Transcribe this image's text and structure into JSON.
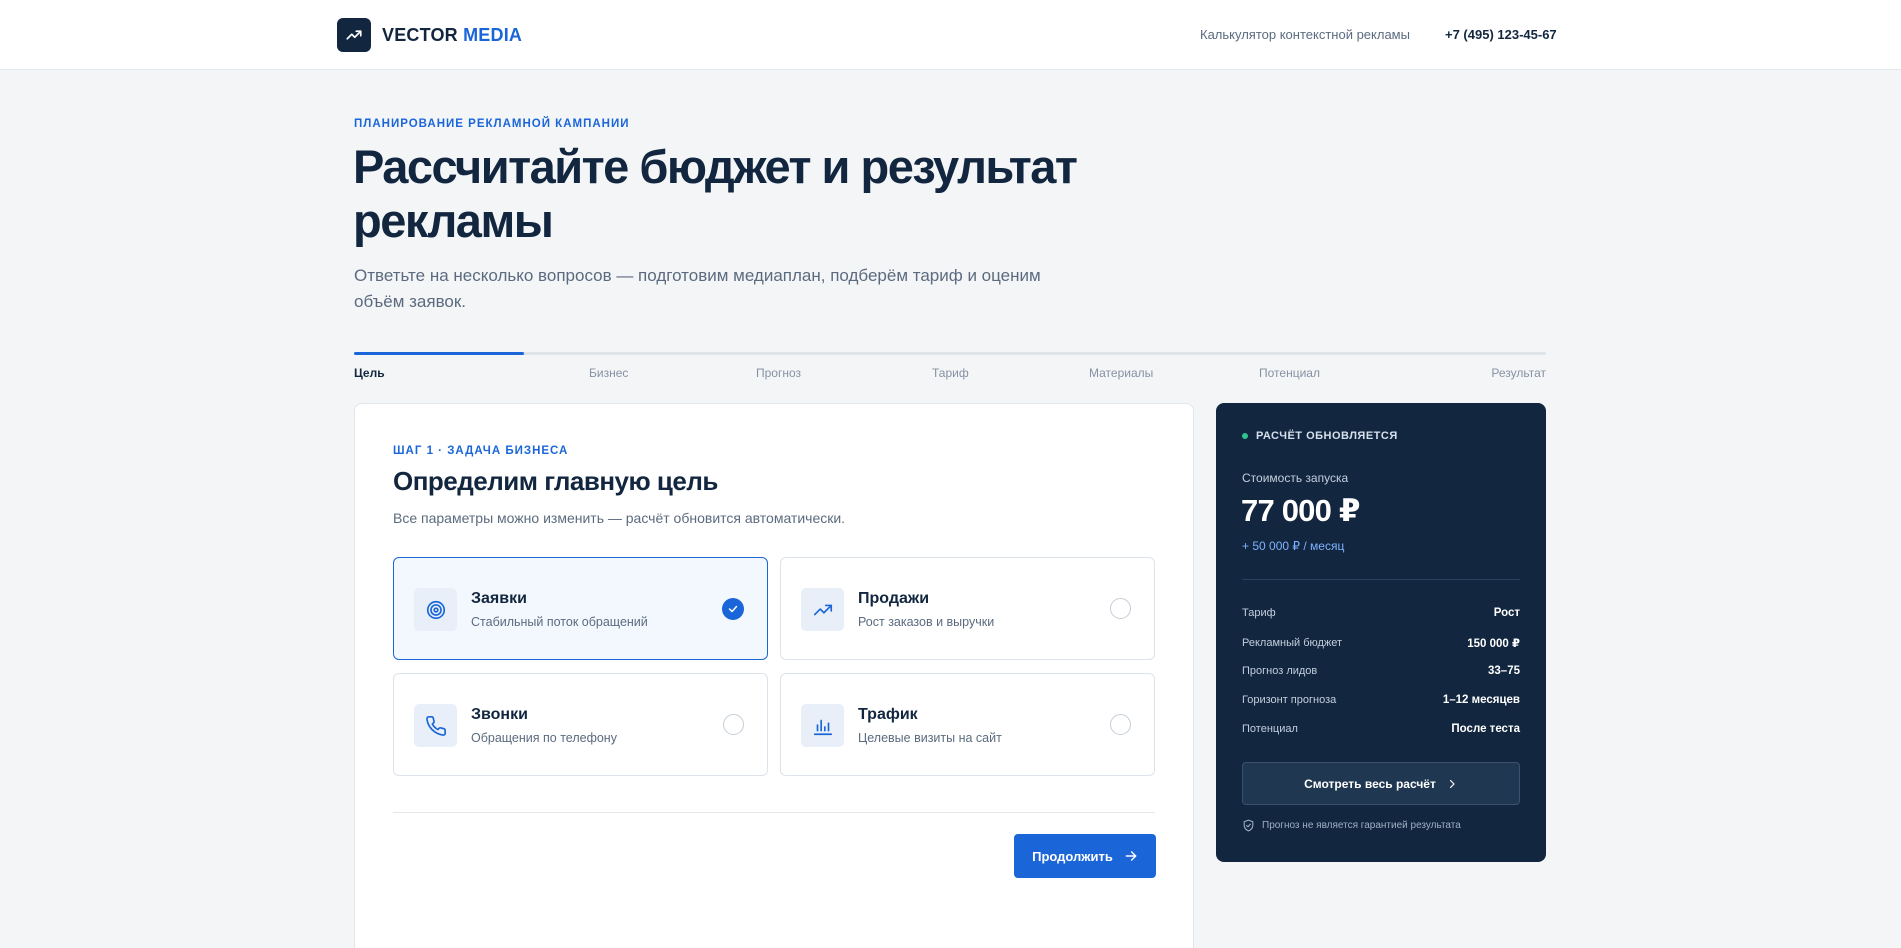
{
  "header": {
    "logo_primary": "VECTOR",
    "logo_accent": "MEDIA",
    "nav_link": "Калькулятор контекстной рекламы",
    "phone": "+7 (495) 123-45-67"
  },
  "hero": {
    "eyebrow": "ПЛАНИРОВАНИЕ РЕКЛАМНОЙ КАМПАНИИ",
    "title": "Рассчитайте бюджет и результат рекламы",
    "subtitle": "Ответьте на несколько вопросов — подготовим медиаплан, подберём тариф и оценим объём заявок."
  },
  "stepper": {
    "progress": 0.143,
    "steps": [
      {
        "label": "Цель",
        "active": true
      },
      {
        "label": "Бизнес",
        "active": false
      },
      {
        "label": "Прогноз",
        "active": false
      },
      {
        "label": "Тариф",
        "active": false
      },
      {
        "label": "Материалы",
        "active": false
      },
      {
        "label": "Потенциал",
        "active": false
      },
      {
        "label": "Результат",
        "active": false
      }
    ]
  },
  "step": {
    "eyebrow": "ШАГ 1 · ЗАДАЧА БИЗНЕСА",
    "title": "Определим главную цель",
    "subtitle": "Все параметры можно изменить — расчёт обновится автоматически.",
    "options": [
      {
        "title": "Заявки",
        "desc": "Стабильный поток обращений",
        "icon": "target-icon",
        "selected": true
      },
      {
        "title": "Продажи",
        "desc": "Рост заказов и выручки",
        "icon": "trending-up-icon",
        "selected": false
      },
      {
        "title": "Звонки",
        "desc": "Обращения по телефону",
        "icon": "phone-icon",
        "selected": false
      },
      {
        "title": "Трафик",
        "desc": "Целевые визиты на сайт",
        "icon": "bar-chart-icon",
        "selected": false
      }
    ],
    "continue_label": "Продолжить"
  },
  "summary": {
    "live_label": "РАСЧЁТ ОБНОВЛЯЕТСЯ",
    "launch_label": "Стоимость запуска",
    "launch_price": "77 000 ₽",
    "monthly": "+ 50 000 ₽ / месяц",
    "rows": [
      {
        "key": "Тариф",
        "value": "Рост"
      },
      {
        "key": "Рекламный бюджет",
        "value": "150 000 ₽"
      },
      {
        "key": "Прогноз лидов",
        "value": "33–75"
      },
      {
        "key": "Горизонт прогноза",
        "value": "1–12 месяцев"
      },
      {
        "key": "Потенциал",
        "value": "После теста"
      }
    ],
    "view_all_label": "Смотреть весь расчёт",
    "disclaimer": "Прогноз не является гарантией результата"
  },
  "colors": {
    "accent": "#1a66d9",
    "dark": "#12263f",
    "live": "#2fc48d"
  }
}
